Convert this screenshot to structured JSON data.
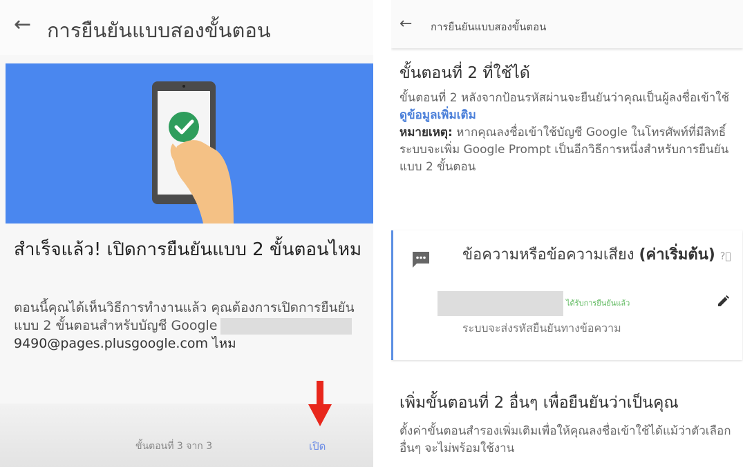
{
  "left": {
    "title": "การยืนยันแบบสองขั้นตอน",
    "back_icon": "arrow-left-icon",
    "heading": "สำเร็จแล้ว! เปิดการยืนยันแบบ 2 ขั้นตอนไหม",
    "body_text": "ตอนนี้คุณได้เห็นวิธีการทำงานแล้ว คุณต้องการเปิดการยืนยันแบบ 2 ขั้นตอนสำหรับบัญชี Google",
    "email": "9490@pages.plusgoogle.com ไหม",
    "step_text": "ขั้นตอนที่ 3 จาก 3",
    "open_label": "เปิด",
    "hero_color": "#4a87ef",
    "arrow_color": "#e8271c"
  },
  "right": {
    "title": "การยืนยันแบบสองขั้นตอน",
    "back_icon": "arrow-left-icon",
    "heading": "ขั้นตอนที่ 2 ที่ใช้ได้",
    "body_text": "ขั้นตอนที่ 2 หลังจากป้อนรหัสผ่านจะยืนยันว่าคุณเป็นผู้ลงชื่อเข้าใช้",
    "learn_more": "ดูข้อมูลเพิ่มเติม",
    "note_label": "หมายเหตุ:",
    "note_text": "หากคุณลงชื่อเข้าใช้บัญชี Google ในโทรศัพท์ที่มีสิทธิ์ ระบบจะเพิ่ม Google Prompt เป็นอีกวิธีการหนึ่งสำหรับการยืนยันแบบ 2 ขั้นตอน",
    "card": {
      "title_normal": "ข้อความหรือข้อความเสียง",
      "title_bold": "(ค่าเริ่มต้น)",
      "help_icon": "help-circle-icon",
      "verified": "ได้รับการยืนยันแล้ว",
      "subtitle": "ระบบจะส่งรหัสยืนยันทางข้อความ",
      "message_icon": "message-icon",
      "edit_icon": "pencil-icon"
    },
    "heading2": "เพิ่มขั้นตอนที่ 2 อื่นๆ เพื่อยืนยันว่าเป็นคุณ",
    "body2": "ตั้งค่าขั้นตอนสำรองเพิ่มเติมเพื่อให้คุณลงชื่อเข้าใช้ได้แม้ว่าตัวเลือกอื่นๆ จะไม่พร้อมใช้งาน",
    "accent_color": "#5b8fe3"
  }
}
